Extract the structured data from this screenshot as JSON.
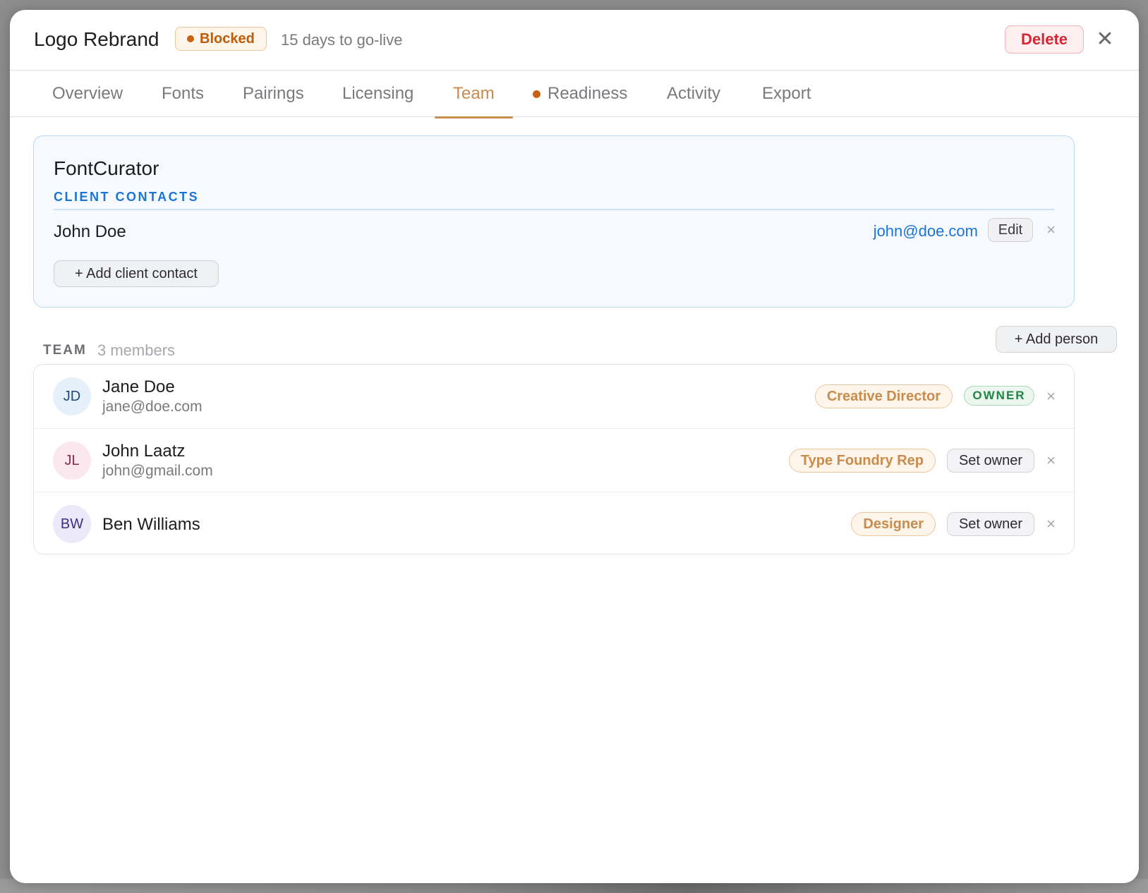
{
  "header": {
    "title": "Logo Rebrand",
    "status": "Blocked",
    "go_live": "15 days to go-live",
    "delete_label": "Delete",
    "close_glyph": "✕"
  },
  "tabs": [
    {
      "label": "Overview",
      "active": false
    },
    {
      "label": "Fonts",
      "active": false
    },
    {
      "label": "Pairings",
      "active": false
    },
    {
      "label": "Licensing",
      "active": false
    },
    {
      "label": "Team",
      "active": true
    },
    {
      "label": "Readiness",
      "active": false,
      "indicator": "warning-dot"
    },
    {
      "label": "Activity",
      "active": false
    },
    {
      "label": "Export",
      "active": false
    }
  ],
  "client": {
    "name": "FontCurator",
    "section_label": "CLIENT CONTACTS",
    "contacts": [
      {
        "name": "John Doe",
        "email": "john@doe.com",
        "edit_label": "Edit",
        "remove_glyph": "×"
      }
    ],
    "add_contact_label": "+ Add client contact"
  },
  "team": {
    "label": "TEAM",
    "count": "3 members",
    "add_person_label": "+ Add person",
    "members": [
      {
        "initials": "JD",
        "name": "Jane Doe",
        "email": "jane@doe.com",
        "role": "Creative Director",
        "owner_badge": "OWNER",
        "remove_glyph": "×"
      },
      {
        "initials": "JL",
        "name": "John Laatz",
        "email": "john@gmail.com",
        "role": "Type Foundry Rep",
        "set_owner_label": "Set owner",
        "remove_glyph": "×"
      },
      {
        "initials": "BW",
        "name": "Ben Williams",
        "email": "",
        "role": "Designer",
        "set_owner_label": "Set owner",
        "remove_glyph": "×"
      }
    ]
  },
  "colors": {
    "accent_tab": "#c98c4c",
    "status_blocked": "#c8620f",
    "link_blue": "#1a75d6",
    "danger": "#d32834",
    "owner_green": "#228544",
    "avatar_jd_bg": "#e6f0fb",
    "avatar_jl_bg": "#fbe8ef",
    "avatar_bw_bg": "#ece9fb"
  }
}
